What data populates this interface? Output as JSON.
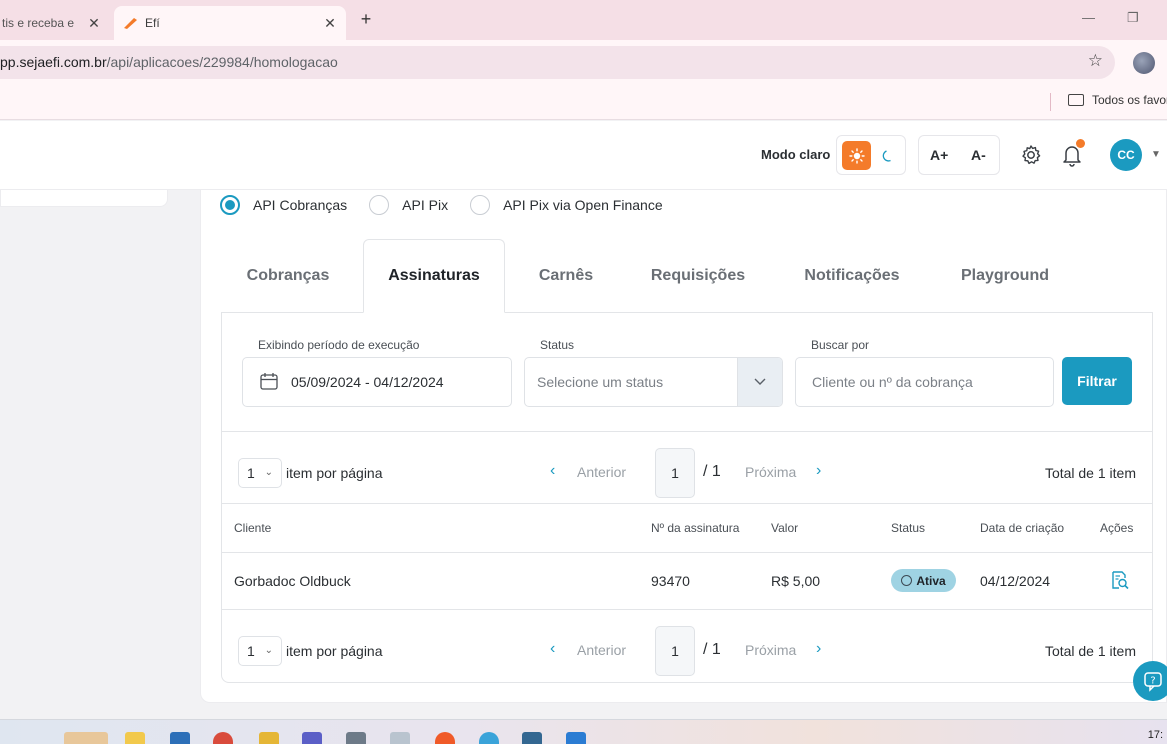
{
  "browser": {
    "tabs": [
      {
        "title": "tis e receba e",
        "active": false
      },
      {
        "title": "Efí",
        "active": true
      }
    ],
    "new_tab": "+",
    "close_glyph": "✕",
    "window_controls": {
      "minimize": "—",
      "restore": "❐"
    },
    "address": {
      "host": "pp.sejaefi.com.br",
      "path": "/api/aplicacoes/229984/homologacao"
    },
    "bookmark": {
      "label": "Todos os favor"
    }
  },
  "header": {
    "mode_label": "Modo claro",
    "font_increase": "A+",
    "font_decrease": "A-",
    "avatar_initials": "CC",
    "accent_color": "#1b9ac0",
    "orange": "#f47b2a"
  },
  "api_options": [
    {
      "label": "API Cobranças",
      "checked": true
    },
    {
      "label": "API Pix",
      "checked": false
    },
    {
      "label": "API Pix via Open Finance",
      "checked": false
    }
  ],
  "tabs": [
    {
      "label": "Cobranças",
      "active": false
    },
    {
      "label": "Assinaturas",
      "active": true
    },
    {
      "label": "Carnês",
      "active": false
    },
    {
      "label": "Requisições",
      "active": false
    },
    {
      "label": "Notificações",
      "active": false
    },
    {
      "label": "Playground",
      "active": false
    }
  ],
  "filters": {
    "period_label": "Exibindo período de execução",
    "period_value": "05/09/2024 - 04/12/2024",
    "status_label": "Status",
    "status_placeholder": "Selecione um status",
    "search_label": "Buscar por",
    "search_placeholder": "Cliente ou nº da cobrança",
    "filter_button": "Filtrar"
  },
  "pagination": {
    "per_page": "1",
    "per_page_label": "item por página",
    "prev": "Anterior",
    "page": "1",
    "of_pages": "/ 1",
    "next": "Próxima",
    "total": "Total de 1 item"
  },
  "table": {
    "columns": [
      "Cliente",
      "Nº da assinatura",
      "Valor",
      "Status",
      "Data de criação",
      "Ações"
    ],
    "rows": [
      {
        "cliente": "Gorbadoc Oldbuck",
        "numero": "93470",
        "valor": "R$ 5,00",
        "status": "Ativa",
        "data": "04/12/2024"
      }
    ]
  },
  "taskbar": {
    "clock": "17:"
  }
}
